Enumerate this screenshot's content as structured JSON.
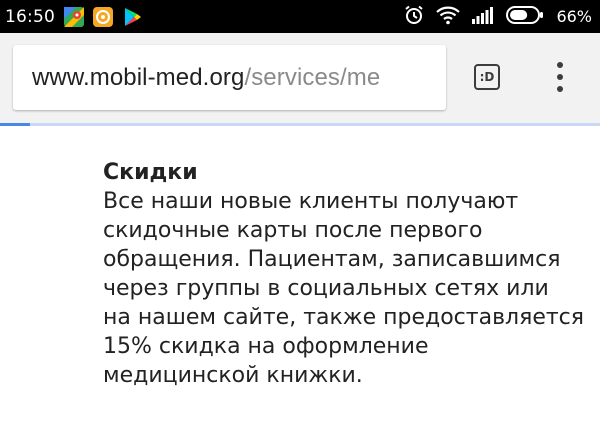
{
  "status_bar": {
    "time": "16:50",
    "battery_percent": "66%",
    "battery_level": 0.66,
    "apps": [
      "maps-app-icon",
      "puzzle-app-icon",
      "play-store-icon"
    ]
  },
  "browser": {
    "url_host": "www.mobil-med.org",
    "url_path": "/services/me",
    "tab_switcher_label": ":D",
    "page_load_progress": 0.05
  },
  "colors": {
    "accent_blue": "#4a86e8",
    "text": "#222222",
    "url_path": "#8a8a8a"
  },
  "page": {
    "cut_off_line": "",
    "heading": "Скидки",
    "body_lines": [
      "Все наши новые клиенты получают",
      "скидочные карты после первого",
      "обращения. Пациентам, записавшимся",
      "через группы в социальных сетях или",
      "на нашем сайте, также предоставляется",
      "15% скидка на оформление",
      "медицинской книжки."
    ]
  }
}
